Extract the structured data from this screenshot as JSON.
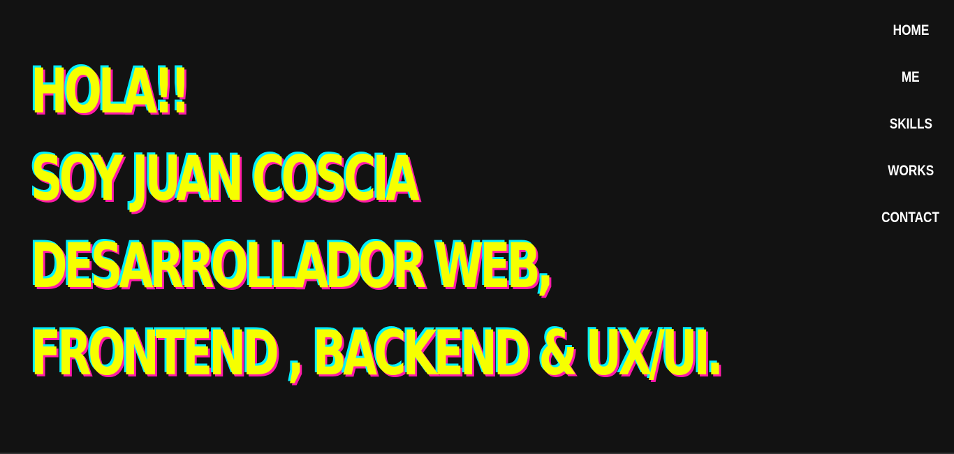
{
  "hero": {
    "lines": [
      "HOLA!!",
      "SOY JUAN COSCIA",
      "DESARROLLADOR WEB,",
      "FRONTEND , BACKEND & UX/UI."
    ]
  },
  "nav": {
    "items": [
      {
        "label": "HOME"
      },
      {
        "label": "ME"
      },
      {
        "label": "SKILLS"
      },
      {
        "label": "WORKS"
      },
      {
        "label": "CONTACT"
      }
    ]
  },
  "colors": {
    "background": "#121212",
    "hero_text": "#f6ff00",
    "hero_shadow_cyan": "#00f0ff",
    "hero_shadow_magenta": "#ff1aa8",
    "nav_text": "#ffffff"
  }
}
